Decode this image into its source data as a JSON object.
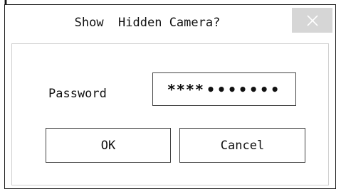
{
  "dialog": {
    "title": "Show  Hidden Camera?",
    "close_icon": "close-icon",
    "password_label": "Password",
    "password_masked": "****",
    "password_dots": "•••••••",
    "ok_label": "OK",
    "cancel_label": "Cancel"
  },
  "colors": {
    "close_button_bg": "#d6d6d6",
    "border": "#444444",
    "inner_border": "#cfcfcf"
  }
}
